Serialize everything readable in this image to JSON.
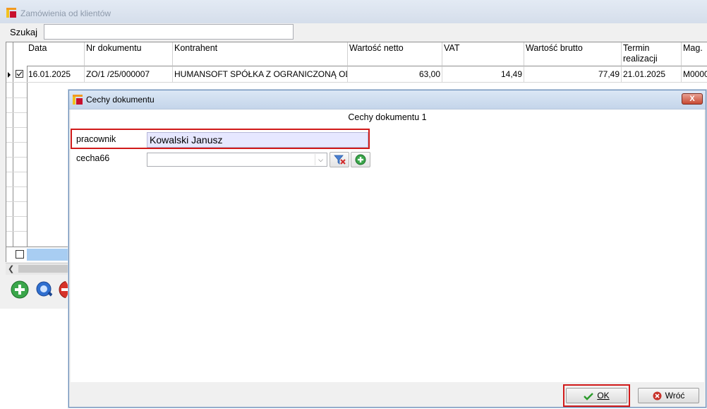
{
  "main_window": {
    "title": "Zamówienia od klientów",
    "search": {
      "label": "Szukaj",
      "value": ""
    },
    "table": {
      "columns": [
        "Data",
        "Nr dokumentu",
        "Kontrahent",
        "Wartość netto",
        "VAT",
        "Wartość brutto",
        "Termin realizacji",
        "Mag."
      ],
      "rows": [
        {
          "data": "16.01.2025",
          "nr_dokumentu": "ZO/1  /25/000007",
          "kontrahent": "HUMANSOFT SPÓŁKA Z OGRANICZONĄ OD",
          "wartosc_netto": "63,00",
          "vat": "14,49",
          "wartosc_brutto": "77,49",
          "termin_realizacji": "21.01.2025",
          "mag": "M0000"
        }
      ]
    },
    "toolbar_icons": [
      "add-icon",
      "preview-icon",
      "delete-icon"
    ]
  },
  "dialog": {
    "title": "Cechy dokumentu",
    "section_title": "Cechy dokumentu 1",
    "fields": [
      {
        "label": "pracownik",
        "value": "Kowalski Janusz"
      },
      {
        "label": "cecha66",
        "value": ""
      }
    ],
    "buttons": {
      "ok": "OK",
      "back": "Wróć"
    },
    "close_label": "X"
  },
  "colors": {
    "highlight": "#d11a1a",
    "selection": "#a8cdf2",
    "field_bg": "#e6e7ff"
  }
}
